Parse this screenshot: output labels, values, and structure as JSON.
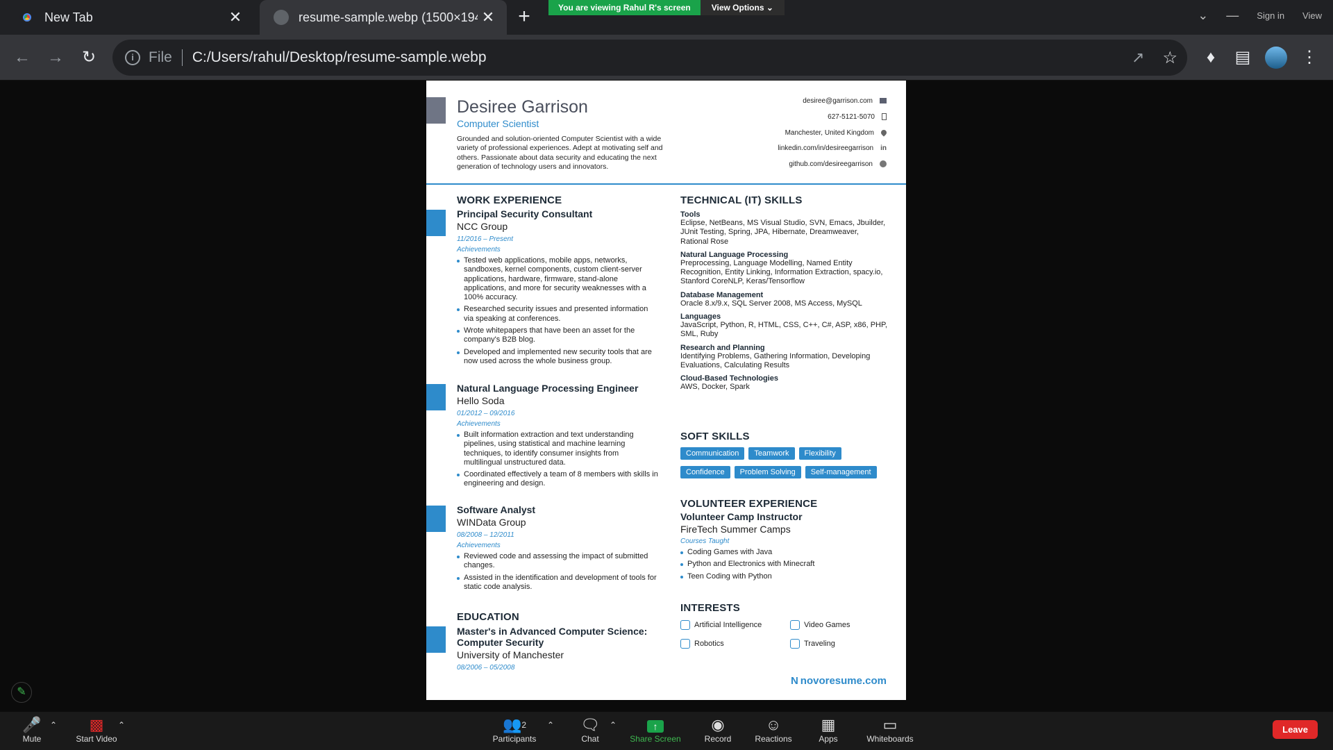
{
  "browser": {
    "tabs": [
      {
        "title": "New Tab",
        "icon": "chrome-icon"
      },
      {
        "title": "resume-sample.webp (1500×194",
        "icon": "globe-icon"
      }
    ],
    "new_tab_label": "+",
    "address": {
      "scheme_label": "File",
      "url": "C:/Users/rahul/Desktop/resume-sample.webp"
    },
    "window": {
      "sign_in": "Sign in",
      "view": "View"
    }
  },
  "zoom_banner": {
    "viewing": "You are viewing Rahul R's screen",
    "options": "View Options"
  },
  "resume": {
    "name": "Desiree Garrison",
    "role": "Computer Scientist",
    "summary": "Grounded and solution-oriented Computer Scientist with a wide variety of professional experiences. Adept at motivating self and others. Passionate about data security and educating the next generation of technology users and innovators.",
    "contacts": [
      {
        "text": "desiree@garrison.com",
        "icon": "mail-icon"
      },
      {
        "text": "627-5121-5070",
        "icon": "phone-icon"
      },
      {
        "text": "Manchester, United Kingdom",
        "icon": "location-icon"
      },
      {
        "text": "linkedin.com/in/desireegarrison",
        "icon": "linkedin-icon"
      },
      {
        "text": "github.com/desireegarrison",
        "icon": "github-icon"
      }
    ],
    "work_heading": "WORK EXPERIENCE",
    "jobs": [
      {
        "title": "Principal Security Consultant",
        "company": "NCC Group",
        "dates": "11/2016 – Present",
        "ach_label": "Achievements",
        "bullets": [
          "Tested web applications, mobile apps, networks, sandboxes, kernel components, custom client-server applications, hardware, firmware, stand-alone applications, and more for security weaknesses with a 100% accuracy.",
          "Researched security issues and presented information via speaking at conferences.",
          "Wrote whitepapers that have been an asset for the company's B2B blog.",
          "Developed and implemented new security tools that are now used across the whole business group."
        ]
      },
      {
        "title": "Natural Language Processing Engineer",
        "company": "Hello Soda",
        "dates": "01/2012 – 09/2016",
        "ach_label": "Achievements",
        "bullets": [
          "Built information extraction and text understanding pipelines, using statistical and machine learning techniques, to identify consumer insights from multilingual unstructured data.",
          "Coordinated effectively a team of 8 members with skills in engineering and design."
        ]
      },
      {
        "title": "Software Analyst",
        "company": "WINData Group",
        "dates": "08/2008 – 12/2011",
        "ach_label": "Achievements",
        "bullets": [
          "Reviewed code and assessing the impact of submitted changes.",
          "Assisted in the identification and development of tools for static code analysis."
        ]
      }
    ],
    "education_heading": "EDUCATION",
    "education": {
      "degree": "Master's in Advanced Computer Science: Computer Security",
      "school": "University of Manchester",
      "dates": "08/2006 – 05/2008"
    },
    "tech_heading": "TECHNICAL (IT) SKILLS",
    "tech_skills": [
      {
        "name": "Tools",
        "value": "Eclipse, NetBeans, MS Visual Studio, SVN, Emacs, Jbuilder, JUnit Testing, Spring, JPA, Hibernate, Dreamweaver, Rational Rose"
      },
      {
        "name": "Natural Language Processing",
        "value": "Preprocessing, Language Modelling, Named Entity Recognition, Entity Linking, Information Extraction, spacy.io, Stanford CoreNLP, Keras/Tensorflow"
      },
      {
        "name": "Database Management",
        "value": "Oracle 8.x/9.x, SQL Server 2008, MS Access, MySQL"
      },
      {
        "name": "Languages",
        "value": "JavaScript, Python, R, HTML, CSS, C++, C#, ASP, x86, PHP, SML, Ruby"
      },
      {
        "name": "Research and Planning",
        "value": "Identifying Problems, Gathering Information, Developing Evaluations, Calculating Results"
      },
      {
        "name": "Cloud-Based Technologies",
        "value": "AWS, Docker, Spark"
      }
    ],
    "soft_heading": "SOFT SKILLS",
    "soft_skills": [
      "Communication",
      "Teamwork",
      "Flexibility",
      "Confidence",
      "Problem Solving",
      "Self-management"
    ],
    "volunteer_heading": "VOLUNTEER EXPERIENCE",
    "volunteer": {
      "title": "Volunteer Camp Instructor",
      "org": "FireTech Summer Camps",
      "courses_label": "Courses Taught",
      "courses": [
        "Coding Games with Java",
        "Python and Electronics with Minecraft",
        "Teen Coding with Python"
      ]
    },
    "interests_heading": "INTERESTS",
    "interests": [
      "Artificial Intelligence",
      "Video Games",
      "Robotics",
      "Traveling"
    ],
    "brand": "novoresume.com"
  },
  "zoom_toolbar": {
    "mute": "Mute",
    "start_video": "Start Video",
    "participants": "Participants",
    "participants_count": "2",
    "chat": "Chat",
    "share_screen": "Share Screen",
    "record": "Record",
    "reactions": "Reactions",
    "apps": "Apps",
    "whiteboards": "Whiteboards",
    "leave": "Leave"
  },
  "colors": {
    "accent": "#2e8bcb",
    "zoom_green": "#1aa34a",
    "leave_red": "#e02828"
  }
}
